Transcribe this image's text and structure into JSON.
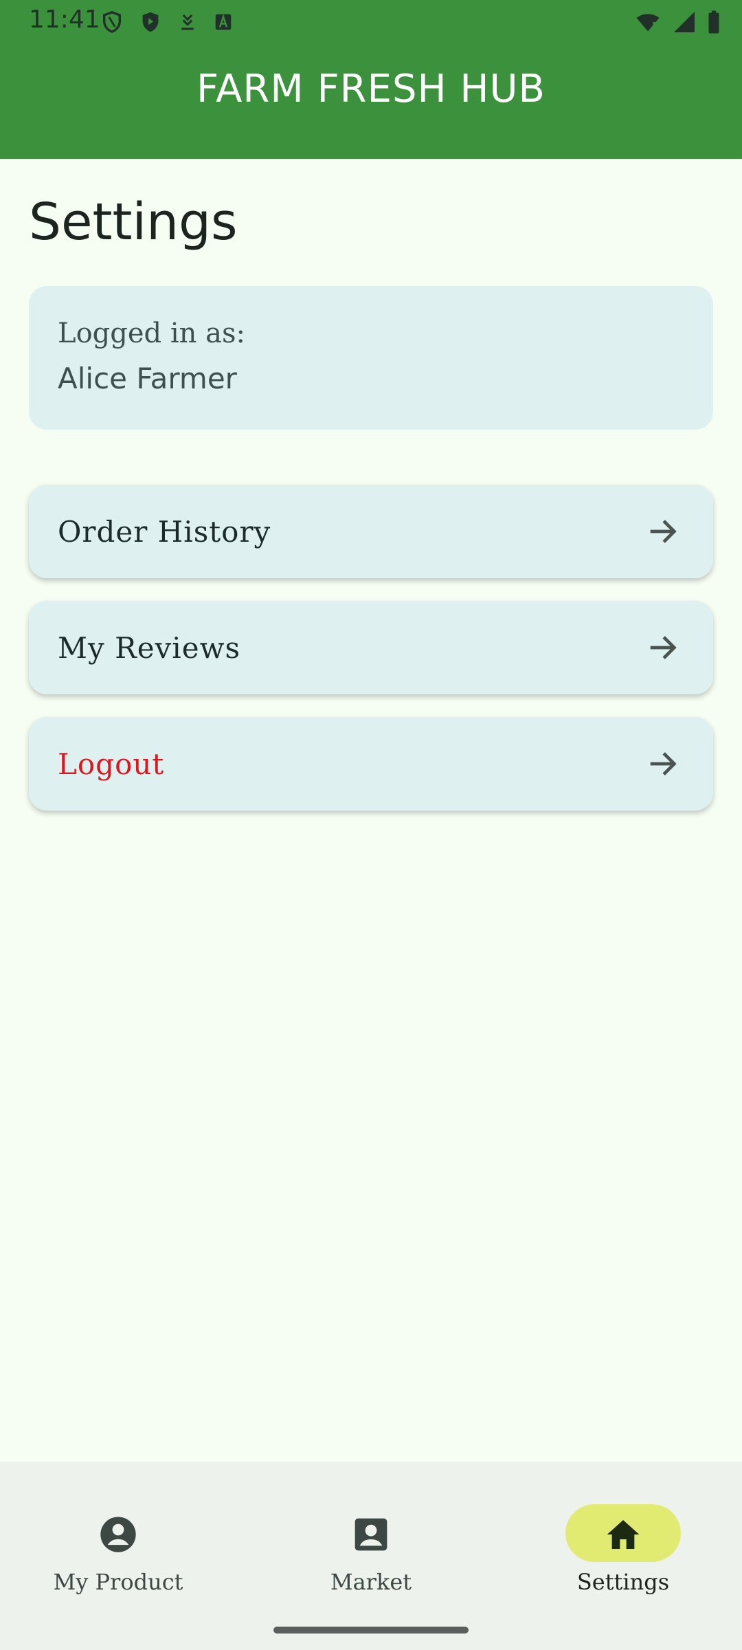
{
  "status_bar": {
    "time": "11:41",
    "left_icons": [
      "vpn-shield-outline-icon",
      "play-shield-icon",
      "download-icon",
      "text-a-icon"
    ],
    "right_icons": [
      "wifi-alert-icon",
      "signal-icon",
      "battery-icon"
    ]
  },
  "app_bar": {
    "title": "FARM FRESH HUB",
    "background": "#3B913C"
  },
  "page": {
    "title": "Settings"
  },
  "user_card": {
    "label": "Logged in as:",
    "name": "Alice Farmer"
  },
  "menu": {
    "items": [
      {
        "label": "Order History",
        "icon": "arrow-right-icon"
      },
      {
        "label": "My Reviews",
        "icon": "arrow-right-icon"
      },
      {
        "label": "Logout",
        "icon": "arrow-right-icon",
        "color": "#E0161E"
      }
    ]
  },
  "bottom_nav": {
    "items": [
      {
        "label": "My Product",
        "icon": "account-circle-icon",
        "active": false
      },
      {
        "label": "Market",
        "icon": "contact-card-icon",
        "active": false
      },
      {
        "label": "Settings",
        "icon": "home-icon",
        "active": true
      }
    ],
    "active_pill_color": "#E1EB72"
  }
}
